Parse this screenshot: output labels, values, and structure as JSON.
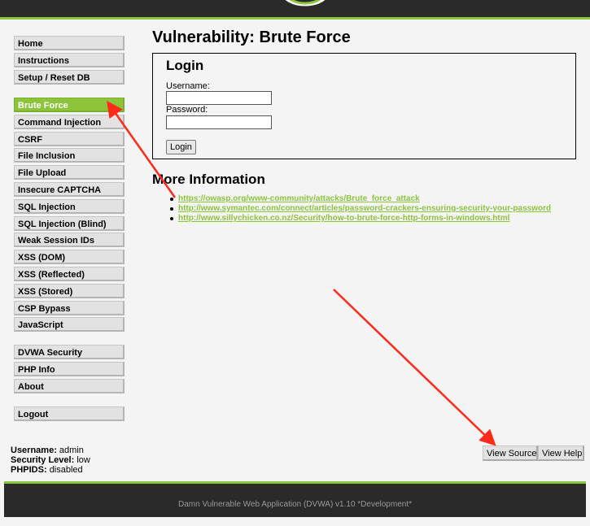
{
  "menu": {
    "group1": [
      "Home",
      "Instructions",
      "Setup / Reset DB"
    ],
    "group2": [
      "Brute Force",
      "Command Injection",
      "CSRF",
      "File Inclusion",
      "File Upload",
      "Insecure CAPTCHA",
      "SQL Injection",
      "SQL Injection (Blind)",
      "Weak Session IDs",
      "XSS (DOM)",
      "XSS (Reflected)",
      "XSS (Stored)",
      "CSP Bypass",
      "JavaScript"
    ],
    "group3": [
      "DVWA Security",
      "PHP Info",
      "About"
    ],
    "group4": [
      "Logout"
    ],
    "selected": "Brute Force"
  },
  "main": {
    "title": "Vulnerability: Brute Force",
    "login": {
      "heading": "Login",
      "username_label": "Username:",
      "username_value": "",
      "password_label": "Password:",
      "password_value": "",
      "button": "Login"
    },
    "more_info_heading": "More Information",
    "links": [
      "https://owasp.org/www-community/attacks/Brute_force_attack",
      "http://www.symantec.com/connect/articles/password-crackers-ensuring-security-your-password",
      "http://www.sillychicken.co.nz/Security/how-to-brute-force-http-forms-in-windows.html"
    ]
  },
  "user_info": {
    "username_label": "Username:",
    "username": "admin",
    "security_label": "Security Level:",
    "security": "low",
    "phpids_label": "PHPIDS:",
    "phpids": "disabled"
  },
  "buttons": {
    "view_source": "View Source",
    "view_help": "View Help"
  },
  "footer": {
    "text": "Damn Vulnerable Web Application (DVWA) v1.10 *Development*"
  },
  "colors": {
    "accent": "#8cc43c",
    "header_bg": "#2a2a2a",
    "annotation_arrow": "#ff2a1a"
  }
}
